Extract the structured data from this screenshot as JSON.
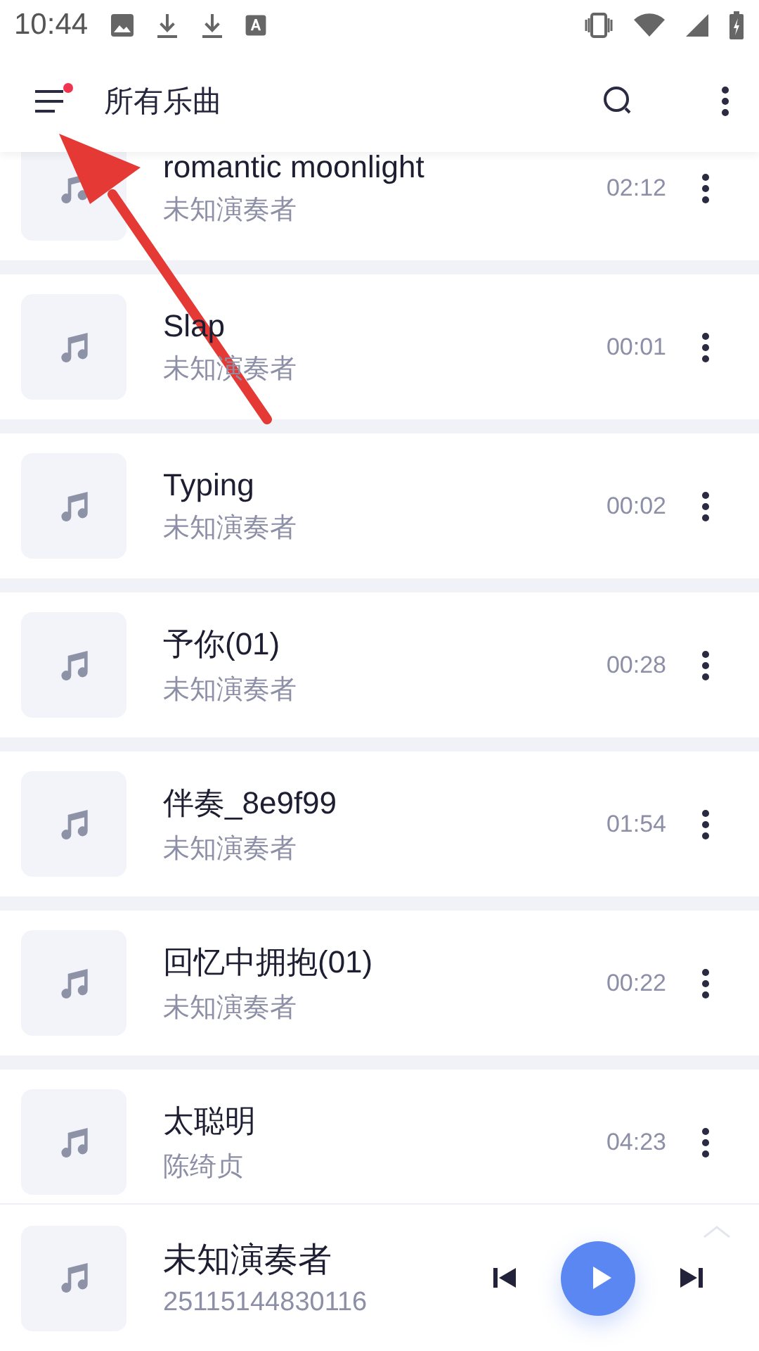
{
  "status_bar": {
    "time": "10:44"
  },
  "app_bar": {
    "title": "所有乐曲",
    "menu_notification": true
  },
  "songs": [
    {
      "title": "romantic moonlight",
      "artist": "未知演奏者",
      "duration": "02:12"
    },
    {
      "title": "Slap",
      "artist": "未知演奏者",
      "duration": "00:01"
    },
    {
      "title": "Typing",
      "artist": "未知演奏者",
      "duration": "00:02"
    },
    {
      "title": "予你(01)",
      "artist": "未知演奏者",
      "duration": "00:28"
    },
    {
      "title": "伴奏_8e9f99",
      "artist": "未知演奏者",
      "duration": "01:54"
    },
    {
      "title": "回忆中拥抱(01)",
      "artist": "未知演奏者",
      "duration": "00:22"
    },
    {
      "title": "太聪明",
      "artist": "陈绮贞",
      "duration": "04:23"
    }
  ],
  "now_playing": {
    "title": "未知演奏者",
    "subtitle": "25115144830116",
    "playing": false
  }
}
